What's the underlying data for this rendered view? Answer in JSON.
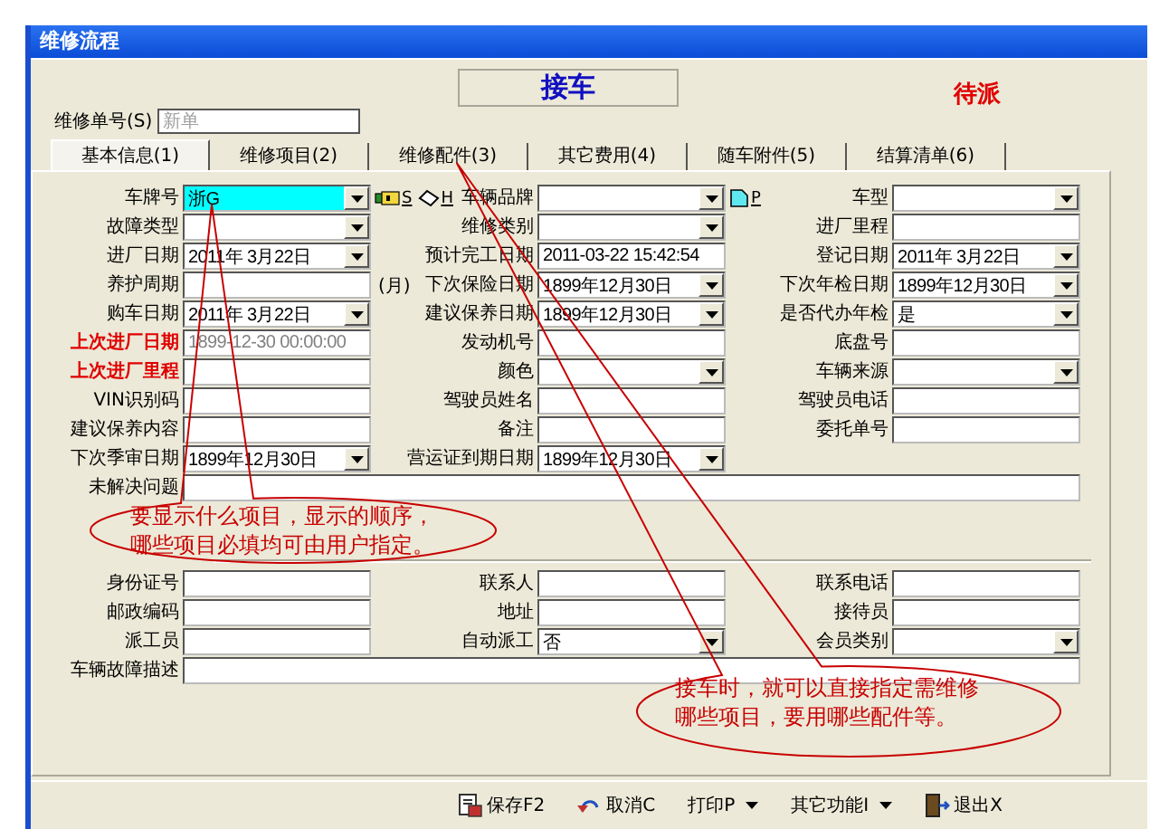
{
  "window": {
    "title": "维修流程"
  },
  "header": {
    "stage": "接车",
    "status": "待派",
    "order_no": {
      "label": "维修单号(S)",
      "placeholder": "新单"
    }
  },
  "tabs": [
    {
      "label": "基本信息(1)",
      "selected": true
    },
    {
      "label": "维修项目(2)",
      "selected": false
    },
    {
      "label": "维修配件(3)",
      "selected": false
    },
    {
      "label": "其它费用(4)",
      "selected": false
    },
    {
      "label": "随车附件(5)",
      "selected": false
    },
    {
      "label": "结算清单(6)",
      "selected": false
    }
  ],
  "sections": [
    {
      "rows": [
        {
          "fields": [
            {
              "label": "车牌号",
              "kind": "combo",
              "value": "浙G",
              "focused": true,
              "tools": [
                {
                  "kind": "key",
                  "hotkey": "S"
                },
                {
                  "kind": "tag",
                  "hotkey": "H"
                }
              ]
            },
            {
              "label": "车辆品牌",
              "kind": "combo",
              "tools": [
                {
                  "kind": "page",
                  "hotkey": "P"
                }
              ]
            },
            {
              "label": "车型",
              "kind": "combo"
            }
          ]
        },
        {
          "fields": [
            {
              "label": "故障类型",
              "kind": "combo"
            },
            {
              "label": "维修类别",
              "kind": "combo"
            },
            {
              "label": "进厂里程",
              "kind": "text"
            }
          ]
        },
        {
          "fields": [
            {
              "label": "进厂日期",
              "kind": "combo",
              "value": "2011年 3月22日"
            },
            {
              "label": "预计完工日期",
              "kind": "text",
              "value": "2011-03-22 15:42:54"
            },
            {
              "label": "登记日期",
              "kind": "combo",
              "value": "2011年 3月22日"
            }
          ]
        },
        {
          "fields": [
            {
              "label": "养护周期",
              "kind": "text",
              "suffix": "(月)"
            },
            {
              "label": "下次保险日期",
              "kind": "combo",
              "value": "1899年12月30日"
            },
            {
              "label": "下次年检日期",
              "kind": "combo",
              "value": "1899年12月30日"
            }
          ]
        },
        {
          "fields": [
            {
              "label": "购车日期",
              "kind": "combo",
              "value": "2011年 3月22日"
            },
            {
              "label": "建议保养日期",
              "kind": "combo",
              "value": "1899年12月30日"
            },
            {
              "label": "是否代办年检",
              "kind": "combo",
              "value": "是"
            }
          ]
        },
        {
          "fields": [
            {
              "label": "上次进厂日期",
              "warn": true,
              "kind": "readonly",
              "value": "1899-12-30 00:00:00"
            },
            {
              "label": "发动机号",
              "kind": "text"
            },
            {
              "label": "底盘号",
              "kind": "text"
            }
          ]
        },
        {
          "fields": [
            {
              "label": "上次进厂里程",
              "warn": true,
              "kind": "text"
            },
            {
              "label": "颜色",
              "kind": "combo"
            },
            {
              "label": "车辆来源",
              "kind": "combo"
            }
          ]
        },
        {
          "fields": [
            {
              "label": "VIN识别码",
              "kind": "text"
            },
            {
              "label": "驾驶员姓名",
              "kind": "text"
            },
            {
              "label": "驾驶员电话",
              "kind": "text"
            }
          ]
        },
        {
          "fields": [
            {
              "label": "建议保养内容",
              "kind": "text"
            },
            {
              "label": "备注",
              "kind": "text"
            },
            {
              "label": "委托单号",
              "kind": "text"
            }
          ]
        },
        {
          "fields": [
            {
              "label": "下次季审日期",
              "kind": "combo",
              "value": "1899年12月30日"
            },
            {
              "label": "营运证到期日期",
              "kind": "combo",
              "value": "1899年12月30日"
            }
          ]
        },
        {
          "fields": [
            {
              "label": "未解决问题",
              "kind": "wide"
            }
          ]
        }
      ]
    },
    {
      "rows": [
        {
          "fields": [
            {
              "label": "身份证号",
              "kind": "text"
            },
            {
              "label": "联系人",
              "kind": "text"
            },
            {
              "label": "联系电话",
              "kind": "text"
            }
          ]
        },
        {
          "fields": [
            {
              "label": "邮政编码",
              "kind": "text"
            },
            {
              "label": "地址",
              "kind": "text"
            },
            {
              "label": "接待员",
              "kind": "text"
            }
          ]
        },
        {
          "fields": [
            {
              "label": "派工员",
              "kind": "text"
            },
            {
              "label": "自动派工",
              "kind": "combo",
              "value": "否"
            },
            {
              "label": "会员类别",
              "kind": "combo"
            }
          ]
        },
        {
          "fields": [
            {
              "label": "车辆故障描述",
              "kind": "memo"
            }
          ]
        }
      ]
    }
  ],
  "toolbar": [
    {
      "label": "保存F2",
      "kind": "save",
      "menu": false
    },
    {
      "label": "取消C",
      "kind": "undo",
      "menu": false
    },
    {
      "label": "打印P",
      "kind": "plain",
      "menu": true
    },
    {
      "label": "其它功能I",
      "kind": "plain",
      "menu": true
    },
    {
      "label": "退出X",
      "kind": "exit",
      "menu": false
    }
  ],
  "callouts": [
    {
      "lines": [
        "要显示什么项目，显示的顺序，",
        "哪些项目必填均可由用户指定。"
      ]
    },
    {
      "lines": [
        "接车时，就可以直接指定需维修",
        "哪些项目，要用哪些配件等。"
      ]
    }
  ]
}
